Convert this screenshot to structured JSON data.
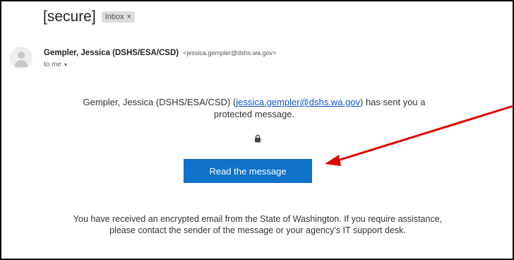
{
  "email": {
    "subject": "[secure]",
    "label_badge": "Inbox",
    "label_badge_close": "×",
    "sender_name": "Gempler, Jessica (DSHS/ESA/CSD)",
    "sender_email_display": "<jessica.gempler@dshs.wa.gov>",
    "to_line": "to me",
    "to_caret": "▾"
  },
  "body": {
    "intro_prefix": "Gempler, Jessica (DSHS/ESA/CSD) (",
    "intro_link": "jessica.gempler@dshs.wa.gov",
    "intro_suffix": ") has sent you a protected message.",
    "button_label": "Read the message",
    "footer": "You have received an encrypted email from the State of Washington. If you require assistance, please contact the sender of the message or your agency's IT support desk."
  },
  "annotation": {
    "arrow_color": "#e00000"
  },
  "colors": {
    "button_bg": "#0f72c8",
    "link": "#1155cc"
  }
}
